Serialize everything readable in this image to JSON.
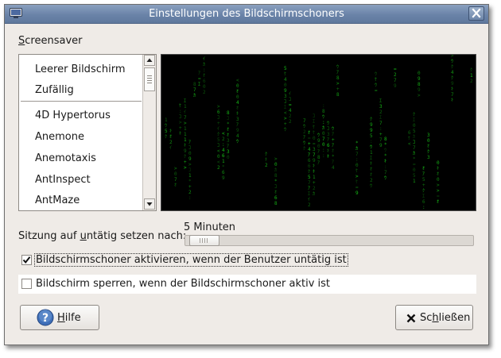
{
  "window": {
    "title": "Einstellungen des Bildschirmschoners"
  },
  "screensaver": {
    "section_label_u": "S",
    "section_label_rest": "creensaver",
    "items": [
      "Leerer Bildschirm",
      "Zufällig",
      "4D Hypertorus",
      "Anemone",
      "Anemotaxis",
      "AntInspect",
      "AntMaze"
    ]
  },
  "idle": {
    "label_before": "Sitzung auf ",
    "label_u": "u",
    "label_after": "ntätig setzen nach:",
    "value": "5 Minuten",
    "fraction": 0.02
  },
  "options": {
    "activate_label": "Bildschirmschoner aktivieren, wenn der Benutzer untätig ist",
    "activate_checked": true,
    "lock_label": "Bildschirm sperren, wenn der Bildschirmschoner aktiv ist",
    "lock_checked": false
  },
  "buttons": {
    "help_u": "H",
    "help_rest": "ilfe",
    "close_before": "Sc",
    "close_u": "h",
    "close_after": "ließen"
  },
  "colors": {
    "matrix_green": "#18c218",
    "titlebar": "#6a83a8"
  },
  "icons": {
    "window": "screen-icon",
    "close": "close-icon",
    "help": "help-circle-icon",
    "close_button": "x-icon"
  }
}
